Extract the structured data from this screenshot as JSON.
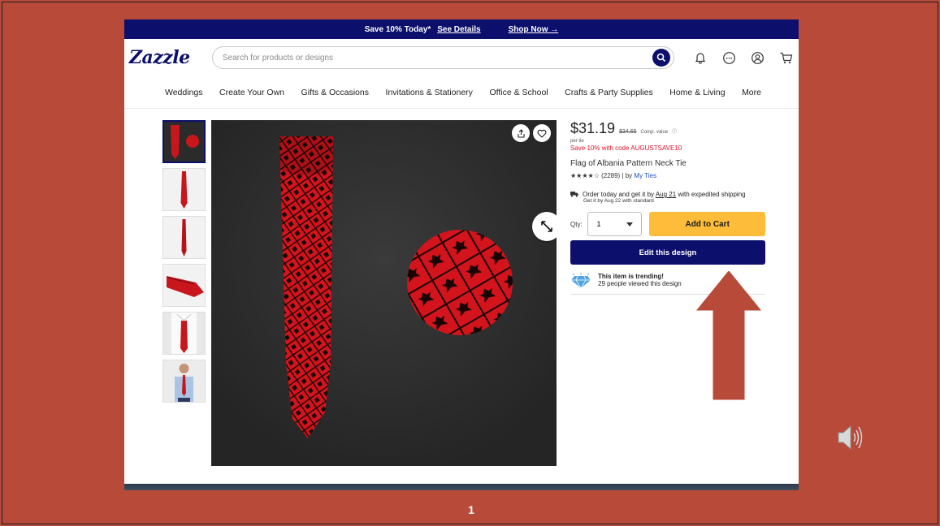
{
  "promo": {
    "text": "Save 10% Today*",
    "details_link": "See Details",
    "shop_link": "Shop Now →"
  },
  "header": {
    "logo": "Zazzle",
    "search_placeholder": "Search for products or designs",
    "icons": [
      "search-icon",
      "bell-icon",
      "chat-icon",
      "account-icon",
      "cart-icon"
    ]
  },
  "nav": {
    "items": [
      "Weddings",
      "Create Your Own",
      "Gifts & Occasions",
      "Invitations & Stationery",
      "Office & School",
      "Crafts & Party Supplies",
      "Home & Living",
      "More"
    ]
  },
  "product": {
    "price": "$31.19",
    "old_price": "$34.65",
    "comp_value": "Comp. value",
    "per_unit": "per tie",
    "sale_text": "Save 10% with code AUGUSTSAVE10",
    "title": "Flag of Albania Pattern Neck Tie",
    "rating_text": "★★★★☆ (2289) | by",
    "seller": "My Ties",
    "shipping_prefix": "Order today and get it by",
    "shipping_date": "Aug 21",
    "shipping_suffix": "with expedited shipping",
    "shipping_standard": "Get it by Aug 22 with standard",
    "qty_label": "Qty:",
    "qty_value": "1",
    "add_to_cart": "Add to Cart",
    "edit_design": "Edit this design",
    "trending_title": "This item is trending!",
    "trending_text": "29 people viewed this design"
  },
  "slide": {
    "page_number": "1",
    "arrow_color": "#b84a3a"
  },
  "colors": {
    "brand_navy": "#0c0f6b",
    "cart_yellow": "#fdbd3a",
    "sale_red": "#e0132b",
    "slide_bg": "#b84a3a"
  }
}
